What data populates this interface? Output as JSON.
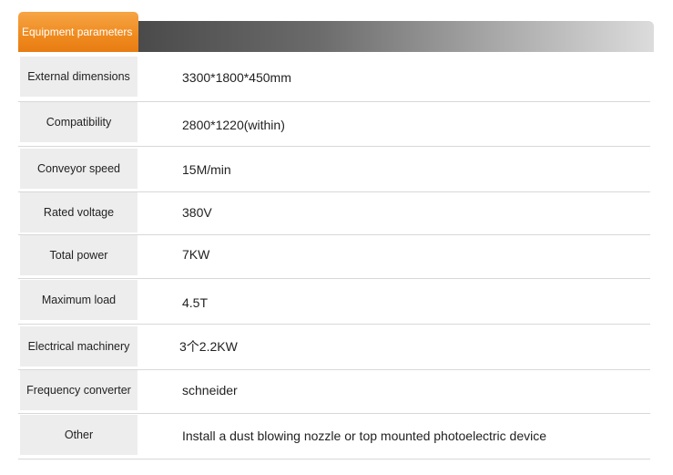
{
  "header": {
    "title": "Equipment parameters"
  },
  "rows": [
    {
      "label": "External dimensions",
      "value": "3300*1800*450mm"
    },
    {
      "label": "Compatibility",
      "value": "2800*1220(within)"
    },
    {
      "label": "Conveyor speed",
      "value": "15M/min"
    },
    {
      "label": "Rated voltage",
      "value": "380V"
    },
    {
      "label": "Total power",
      "value": "7KW"
    },
    {
      "label": "Maximum load",
      "value": "4.5T"
    },
    {
      "label": "Electrical machinery",
      "value": "3个2.2KW"
    },
    {
      "label": "Frequency converter",
      "value": "schneider"
    },
    {
      "label": "Other",
      "value": "Install a dust blowing nozzle or top mounted photoelectric device"
    }
  ]
}
